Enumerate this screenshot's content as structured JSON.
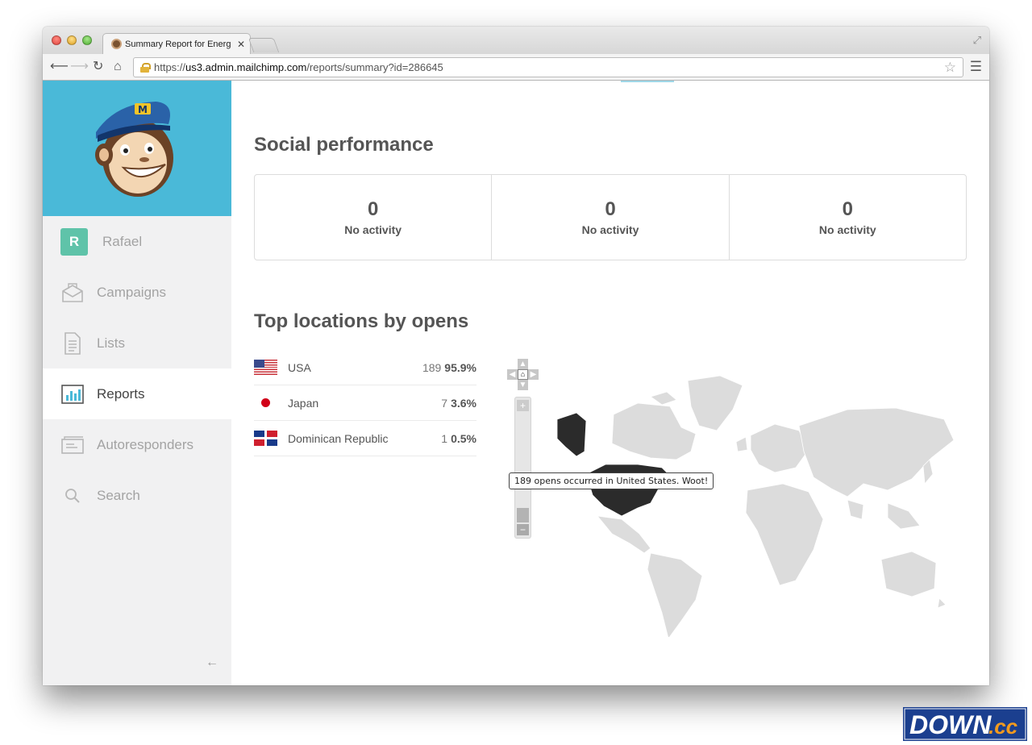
{
  "browser": {
    "tab_title": "Summary Report for Energ",
    "url_prefix": "https://",
    "url_host": "us3.admin.mailchimp.com",
    "url_path": "/reports/summary?id=286645"
  },
  "sidebar": {
    "user": {
      "initial": "R",
      "name": "Rafael"
    },
    "items": [
      {
        "label": "Campaigns",
        "icon": "envelope-icon",
        "active": false
      },
      {
        "label": "Lists",
        "icon": "document-icon",
        "active": false
      },
      {
        "label": "Reports",
        "icon": "bar-chart-icon",
        "active": true
      },
      {
        "label": "Autoresponders",
        "icon": "autoresponder-icon",
        "active": false
      },
      {
        "label": "Search",
        "icon": "search-icon",
        "active": false
      }
    ],
    "collapse_glyph": "←"
  },
  "social": {
    "title": "Social performance",
    "cells": [
      {
        "count": "0",
        "label": "No activity"
      },
      {
        "count": "0",
        "label": "No activity"
      },
      {
        "count": "0",
        "label": "No activity"
      }
    ]
  },
  "locations": {
    "title": "Top locations by opens",
    "rows": [
      {
        "country": "USA",
        "count": "189",
        "percent": "95.9%",
        "flag": "usa"
      },
      {
        "country": "Japan",
        "count": "7",
        "percent": "3.6%",
        "flag": "japan"
      },
      {
        "country": "Dominican Republic",
        "count": "1",
        "percent": "0.5%",
        "flag": "dominican-republic"
      }
    ],
    "map_tooltip": "189 opens occurred in United States. Woot!",
    "colors": {
      "highlight": "#2b2b2b",
      "land": "#dcdcdc"
    }
  },
  "watermark": {
    "text_main": "DOWN",
    "text_suffix": ".cc"
  },
  "colors": {
    "brand_blue": "#4ab9d8",
    "avatar_green": "#5fc3a9",
    "sidebar_bg": "#f1f1f2"
  }
}
